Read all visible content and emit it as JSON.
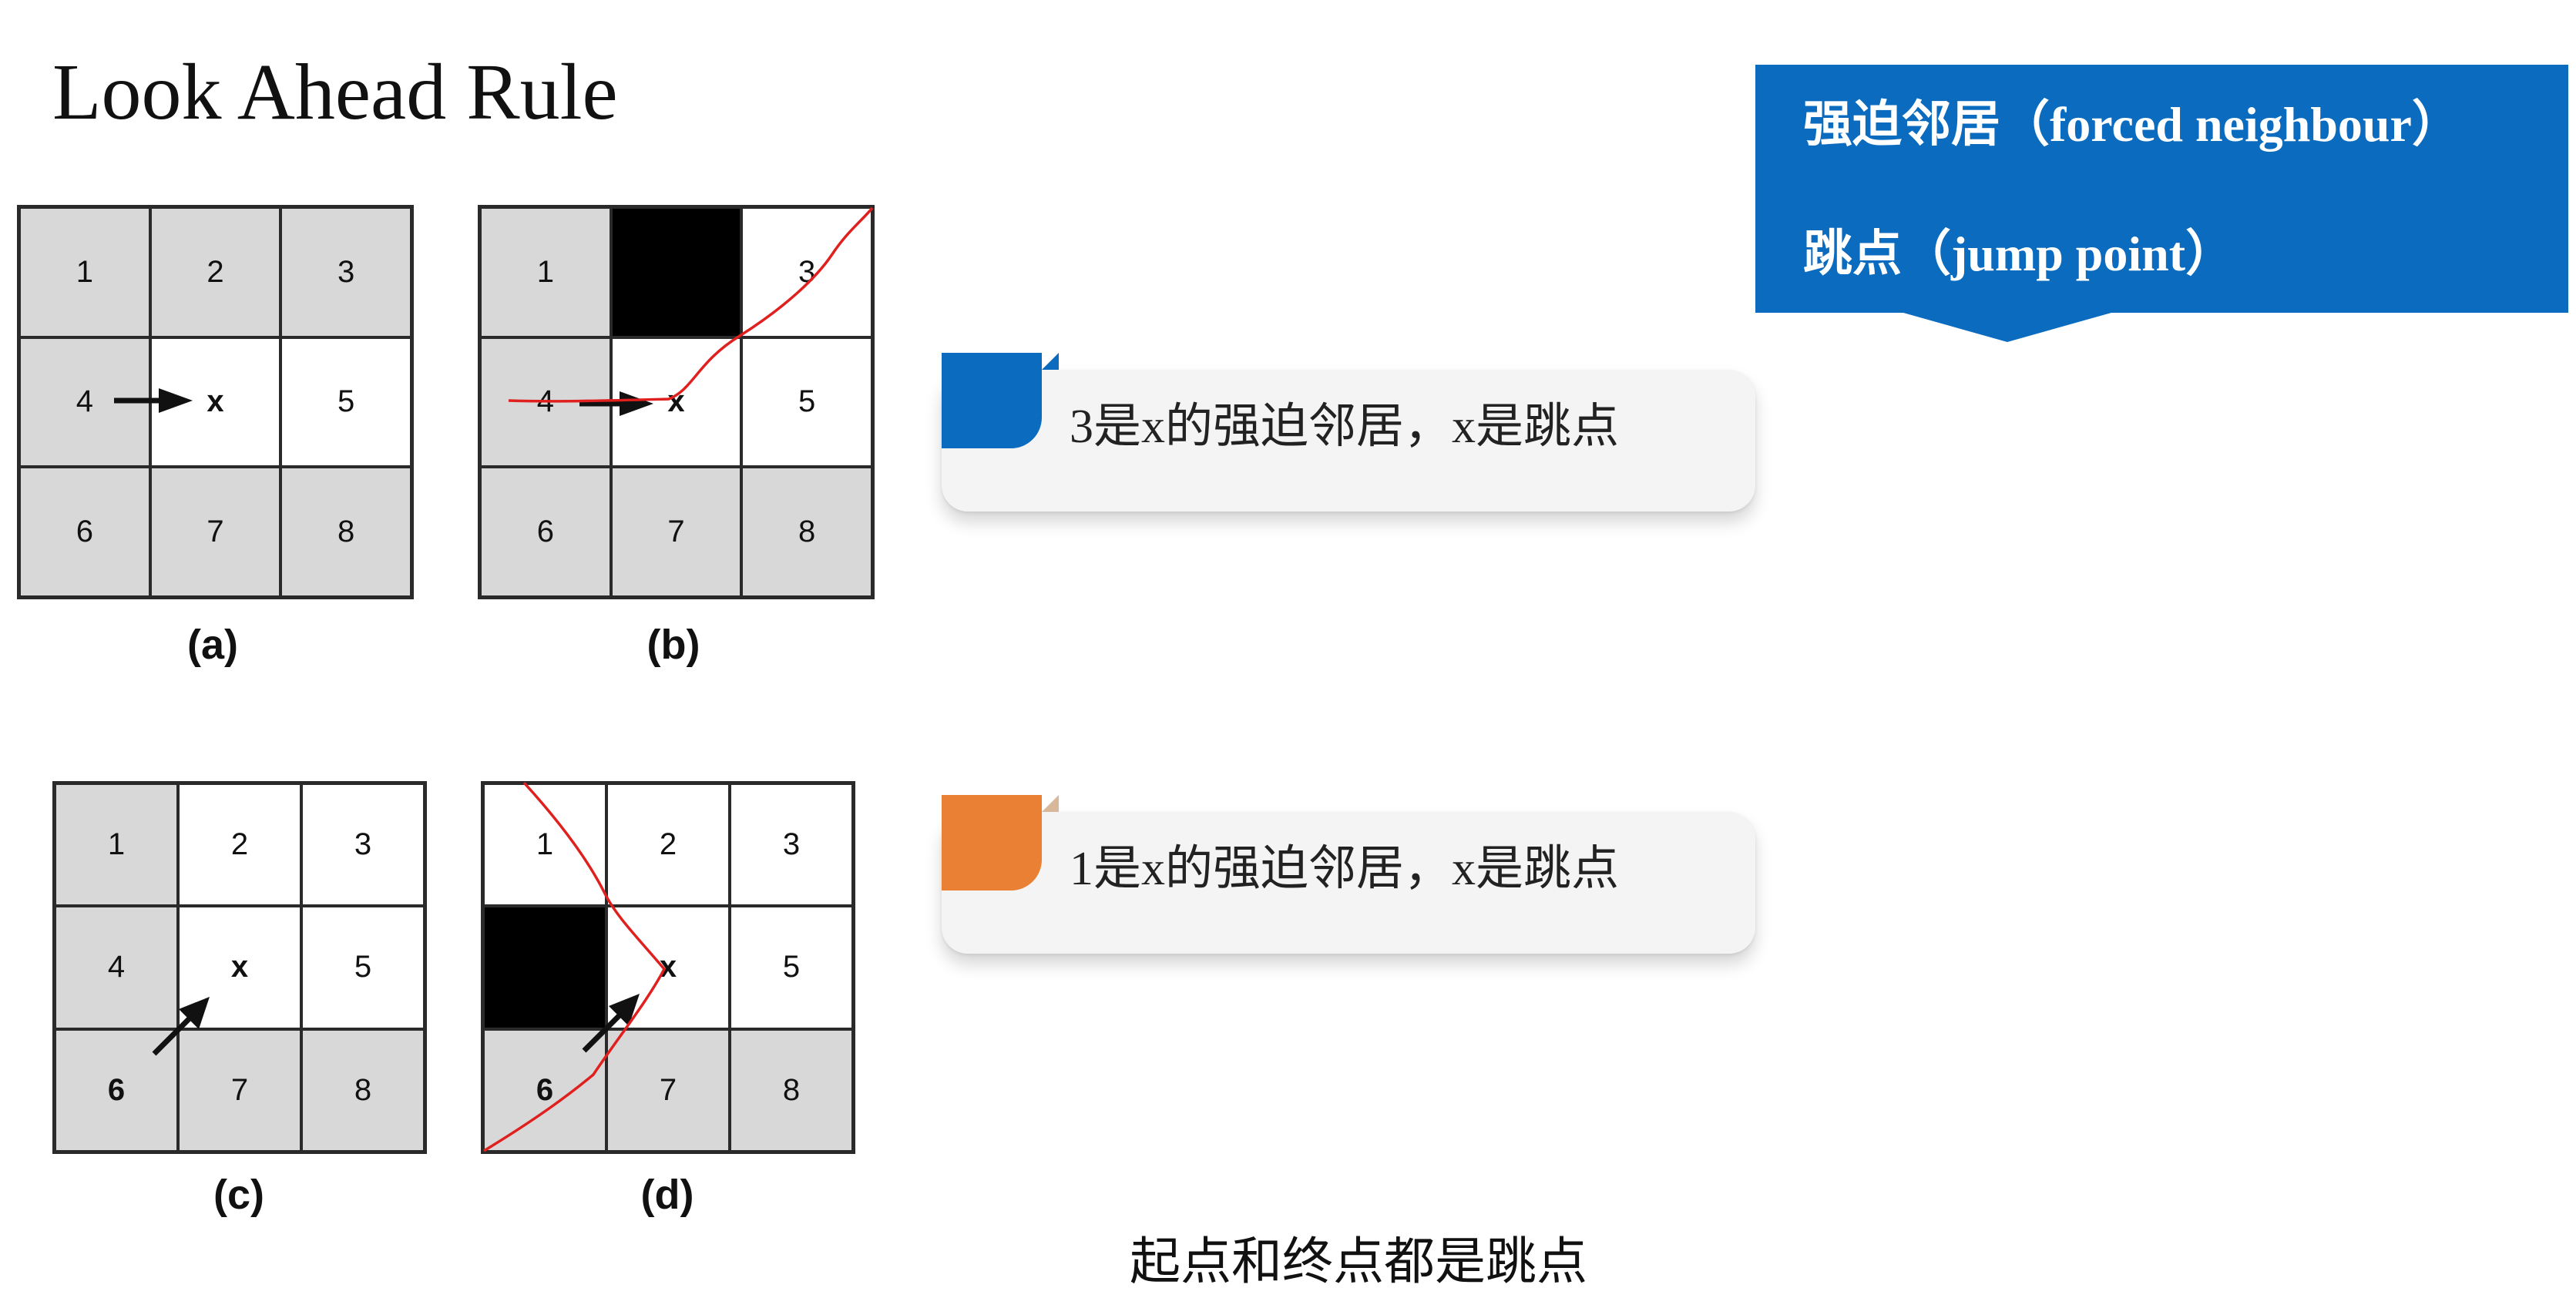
{
  "title": "Look Ahead Rule",
  "grids": {
    "a": {
      "caption": "(a)",
      "cells": [
        "1",
        "2",
        "3",
        "4",
        "x",
        "5",
        "6",
        "7",
        "8"
      ]
    },
    "b": {
      "caption": "(b)",
      "cells": [
        "1",
        "",
        "3",
        "4",
        "x",
        "5",
        "6",
        "7",
        "8"
      ]
    },
    "c": {
      "caption": "(c)",
      "cells": [
        "1",
        "2",
        "3",
        "4",
        "x",
        "5",
        "6",
        "7",
        "8"
      ]
    },
    "d": {
      "caption": "(d)",
      "cells": [
        "1",
        "2",
        "3",
        "",
        "x",
        "5",
        "6",
        "7",
        "8"
      ]
    }
  },
  "callouts": [
    {
      "text": "3是x的强迫邻居，x是跳点",
      "tag_color": "#0a6bbf"
    },
    {
      "text": "1是x的强迫邻居，x是跳点",
      "tag_color": "#e98033"
    }
  ],
  "legend": {
    "line1": "强迫邻居（forced neighbour）",
    "line2": "跳点（jump point）",
    "color": "#0a6bbf"
  },
  "footer": "起点和终点都是跳点",
  "colors": {
    "cell_gray": "#d8d8d8",
    "obstacle": "#000000",
    "annotation": "#e0201e"
  }
}
